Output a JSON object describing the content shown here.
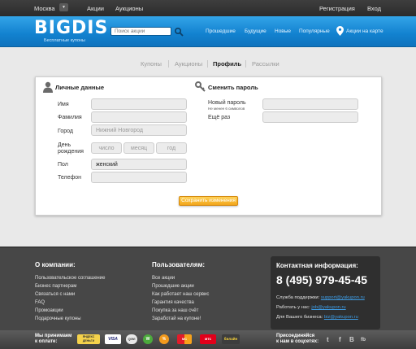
{
  "topbar": {
    "city": "Москва",
    "city_dropdown_glyph": "▼",
    "nav": [
      "Акции",
      "Аукционы"
    ],
    "register": "Регистрация",
    "login": "Вход"
  },
  "header": {
    "logo": "BIGDIS",
    "tagline": "Бесплатные купоны",
    "search_placeholder": "Поиск акции",
    "nav": [
      "Прошедшие",
      "Будущие",
      "Новые",
      "Популярные"
    ],
    "map_link": "Акции на карте"
  },
  "tabs": [
    {
      "label": "Купоны",
      "active": false
    },
    {
      "label": "Аукционы",
      "active": false
    },
    {
      "label": "Профиль",
      "active": true
    },
    {
      "label": "Рассылки",
      "active": false
    }
  ],
  "personal": {
    "title": "Личные данные",
    "name_label": "Имя",
    "surname_label": "Фамилия",
    "city_label": "Город",
    "city_placeholder": "Нижний Новгород",
    "birthday_label": "День рождения",
    "day_placeholder": "число",
    "month_placeholder": "месяц",
    "year_placeholder": "год",
    "gender_label": "Пол",
    "gender_value": "женский",
    "phone_label": "Телефон"
  },
  "password": {
    "title": "Сменить пароль",
    "new_label": "Новый пароль",
    "new_hint": "Не менее 6 символов",
    "repeat_label": "Ещё раз"
  },
  "save_button": "Сохранить изменения",
  "footer": {
    "about_title": "О компании:",
    "about_links": [
      "Пользовательское соглашение",
      "Бизнес партнерам",
      "Связаться с нами",
      "FAQ",
      "Промоакции",
      "Подарочные купоны"
    ],
    "users_title": "Пользователям:",
    "users_links": [
      "Все акции",
      "Прошедшие акции",
      "Как работает наш сервис",
      "Гарантия качества",
      "Покупка за наш счёт",
      "Заработай на купоне!"
    ],
    "contact_title": "Контактная информация:",
    "phone": "8 (495) 979-45-45",
    "support_label": "Служба поддержки:",
    "support_email": "support@yakupon.ru",
    "work_label": "Работать у нас:",
    "work_email": "job@yakupon.ru",
    "biz_label": "Для Вашего бизнеса:",
    "biz_email": "biz@yakupon.ru"
  },
  "paybar": {
    "accept_label_1": "Мы принимаем",
    "accept_label_2": "к оплате:",
    "methods": [
      "ЯНДЕКС ДЕНЬГИ",
      "VISA",
      "QIWI",
      "W",
      "%",
      "MC",
      "мтс",
      "билайн"
    ],
    "social_label_1": "Присоединяйся",
    "social_label_2": "к нам в соцсетях:",
    "social": [
      "t",
      "f",
      "B",
      "fb"
    ]
  },
  "colors": {
    "header_blue": "#1281cf",
    "accent_orange": "#f2a61b",
    "link_blue": "#3d9be3",
    "footer_bg": "#474747"
  }
}
